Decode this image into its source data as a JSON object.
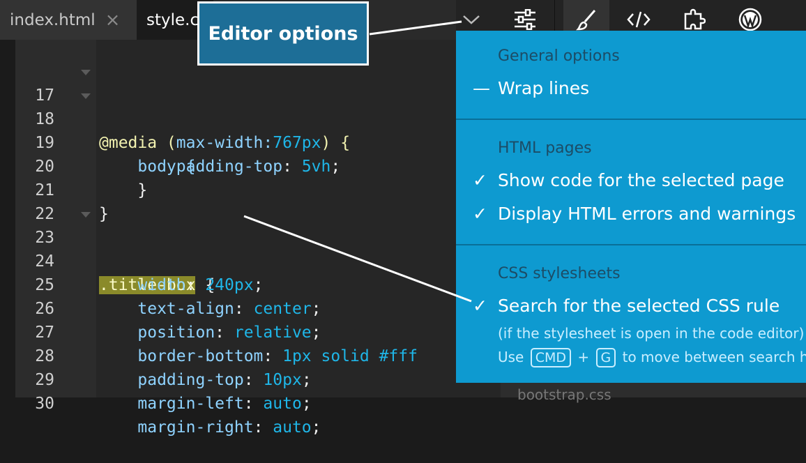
{
  "tabs": [
    {
      "label": "index.html",
      "close": "×"
    },
    {
      "label": "style.c"
    }
  ],
  "toolbar": {
    "icons": [
      "chevron-down-icon",
      "sliders-icon",
      "brush-icon",
      "code-icon",
      "puzzle-icon",
      "wordpress-icon"
    ]
  },
  "callout": {
    "label": "Editor options"
  },
  "code_lines": [
    {
      "n": "17",
      "fold": true
    },
    {
      "n": "18",
      "fold": true
    },
    {
      "n": "19"
    },
    {
      "n": "20"
    },
    {
      "n": "21"
    },
    {
      "n": "22"
    },
    {
      "n": "23",
      "fold": true
    },
    {
      "n": "24"
    },
    {
      "n": "25"
    },
    {
      "n": "26"
    },
    {
      "n": "27"
    },
    {
      "n": "28"
    },
    {
      "n": "29"
    },
    {
      "n": "30"
    }
  ],
  "code": {
    "l17a": "@media (",
    "l17b": "max-width:",
    "l17c": "767px",
    "l17d": ") {",
    "l18": "    body {",
    "l19a": "        padding-top",
    "l19b": ": ",
    "l19c": "5vh",
    "l19d": ";",
    "l20": "    }",
    "l21": "}",
    "l23a": ".title-box",
    "l23b": " {",
    "l24a": "    width",
    "l24b": ": ",
    "l24c": "240px",
    "l24d": ";",
    "l25a": "    text-align",
    "l25c": "center",
    "l26a": "    position",
    "l26c": "relative",
    "l27a": "    border-bottom",
    "l27c": "1px solid #fff",
    "l28a": "    padding-top",
    "l28c": "10px",
    "l29a": "    margin-left",
    "l29c": "auto",
    "l30a": "    margin-right",
    "l30c": "auto",
    "colon": ": ",
    "semi": ";"
  },
  "side_panel": {
    "file": "bootstrap.css"
  },
  "dropdown": {
    "general_header": "General options",
    "wrap_lines": "Wrap lines",
    "wrap_mark": "—",
    "html_header": "HTML pages",
    "show_code": "Show code for the selected page",
    "display_errors": "Display HTML errors and warnings",
    "css_header": "CSS stylesheets",
    "search_rule": "Search for the selected CSS rule",
    "note1": "(if the stylesheet is open in the code editor)",
    "note2_use": "Use",
    "key_cmd": "CMD",
    "plus": "+",
    "key_g": "G",
    "note2_rest": "to move between search h",
    "check": "✓"
  },
  "colors": {
    "dropdown_bg": "#0e9ad0",
    "callout_bg": "#1d6e97",
    "highlight": "#8a8a2a"
  }
}
